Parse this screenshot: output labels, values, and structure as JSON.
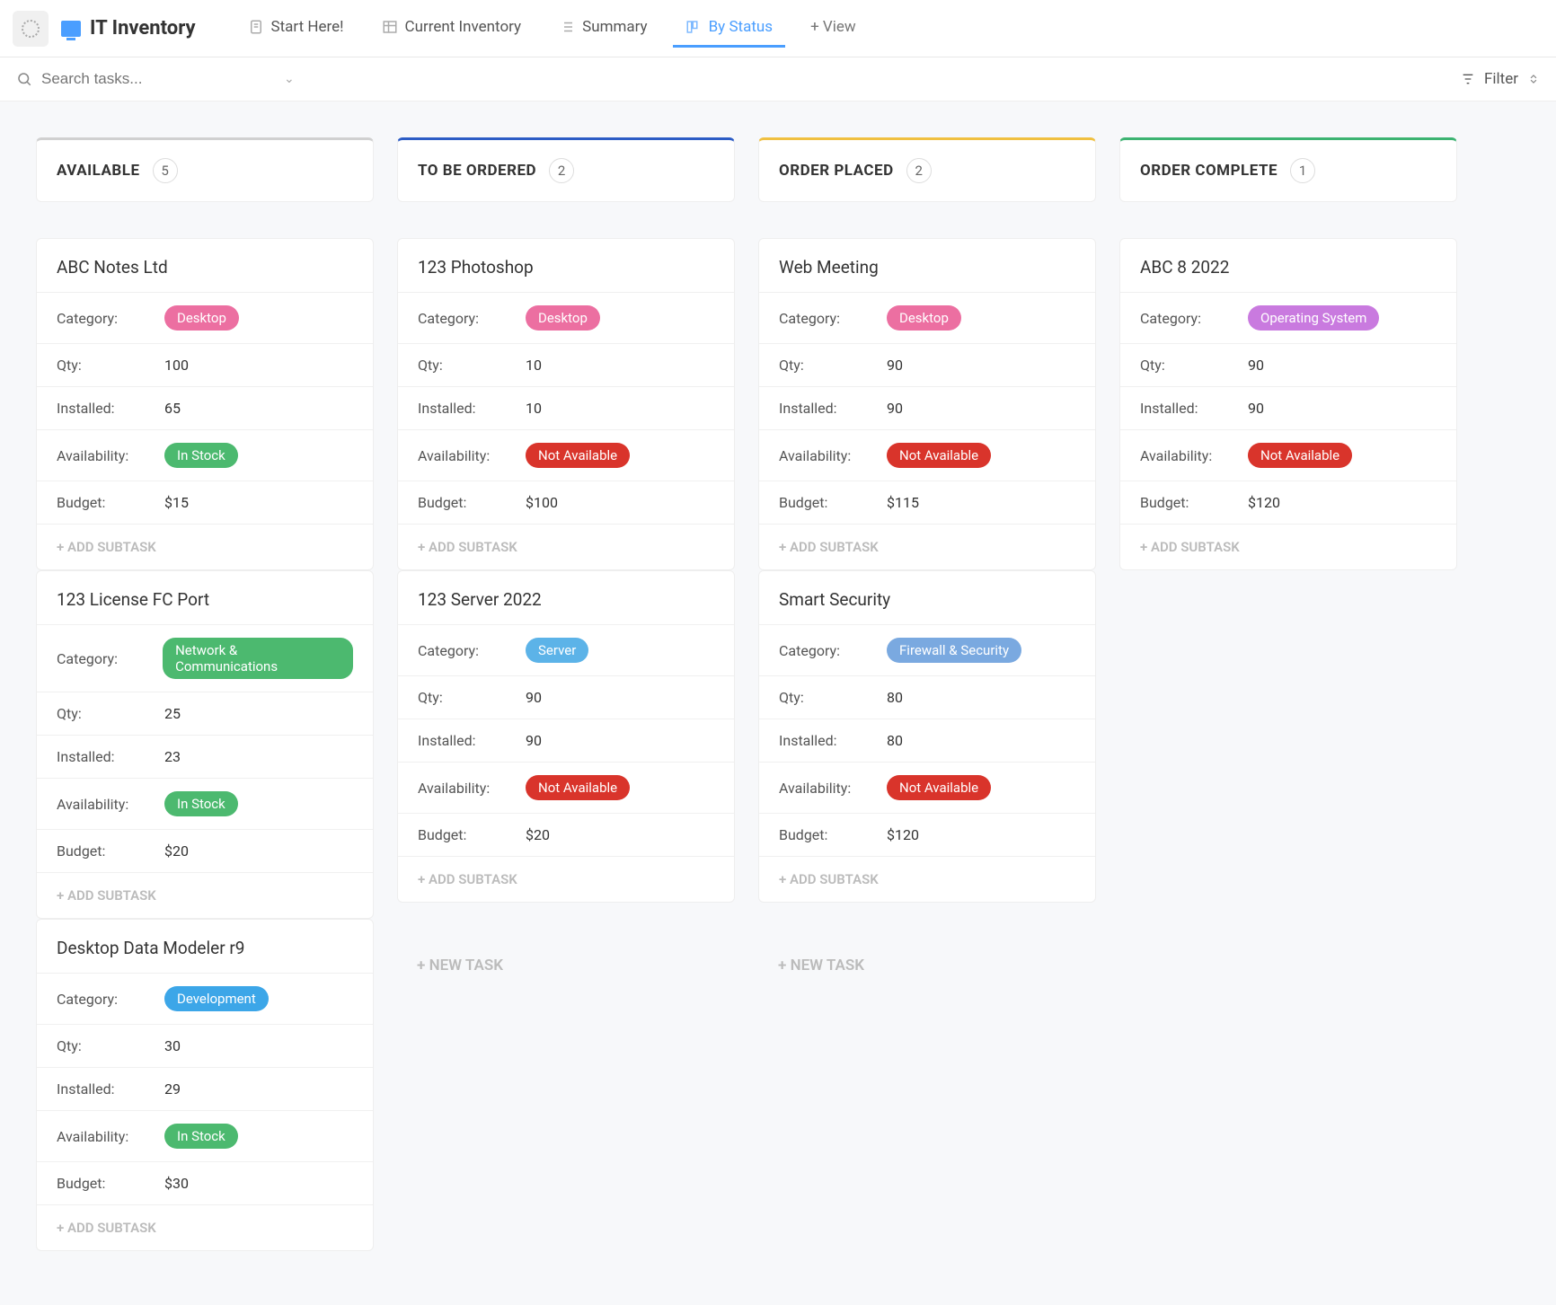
{
  "header": {
    "title": "IT Inventory",
    "tabs": [
      {
        "label": "Start Here!"
      },
      {
        "label": "Current Inventory"
      },
      {
        "label": "Summary"
      },
      {
        "label": "By Status"
      }
    ],
    "add_view": "+  View"
  },
  "search": {
    "placeholder": "Search tasks...",
    "filter_label": "Filter"
  },
  "labels": {
    "category": "Category:",
    "qty": "Qty:",
    "installed": "Installed:",
    "availability": "Availability:",
    "budget": "Budget:",
    "add_subtask": "+ ADD SUBTASK",
    "new_task": "+ NEW TASK"
  },
  "columns": [
    {
      "key": "available",
      "title": "AVAILABLE",
      "count": "5",
      "cards": [
        {
          "title": "ABC Notes Ltd",
          "category": "Desktop",
          "category_pill": "pill-desktop",
          "qty": "100",
          "installed": "65",
          "availability": "In Stock",
          "avail_pill": "pill-instock",
          "budget": "$15"
        },
        {
          "title": "123 License FC Port",
          "category": "Network & Communications",
          "category_pill": "pill-network",
          "qty": "25",
          "installed": "23",
          "availability": "In Stock",
          "avail_pill": "pill-instock",
          "budget": "$20"
        },
        {
          "title": "Desktop Data Modeler r9",
          "category": "Development",
          "category_pill": "pill-development",
          "qty": "30",
          "installed": "29",
          "availability": "In Stock",
          "avail_pill": "pill-instock",
          "budget": "$30"
        }
      ]
    },
    {
      "key": "tobeordered",
      "title": "TO BE ORDERED",
      "count": "2",
      "cards": [
        {
          "title": "123 Photoshop",
          "category": "Desktop",
          "category_pill": "pill-desktop",
          "qty": "10",
          "installed": "10",
          "availability": "Not Available",
          "avail_pill": "pill-notavail",
          "budget": "$100"
        },
        {
          "title": "123 Server 2022",
          "category": "Server",
          "category_pill": "pill-server",
          "qty": "90",
          "installed": "90",
          "availability": "Not Available",
          "avail_pill": "pill-notavail",
          "budget": "$20"
        }
      ],
      "show_new_task": true
    },
    {
      "key": "orderplaced",
      "title": "ORDER PLACED",
      "count": "2",
      "cards": [
        {
          "title": "Web Meeting",
          "category": "Desktop",
          "category_pill": "pill-desktop",
          "qty": "90",
          "installed": "90",
          "availability": "Not Available",
          "avail_pill": "pill-notavail",
          "budget": "$115"
        },
        {
          "title": "Smart Security",
          "category": "Firewall & Security",
          "category_pill": "pill-firewall",
          "qty": "80",
          "installed": "80",
          "availability": "Not Available",
          "avail_pill": "pill-notavail",
          "budget": "$120"
        }
      ],
      "show_new_task": true
    },
    {
      "key": "ordercomplete",
      "title": "ORDER COMPLETE",
      "count": "1",
      "cards": [
        {
          "title": "ABC 8 2022",
          "category": "Operating System",
          "category_pill": "pill-os",
          "qty": "90",
          "installed": "90",
          "availability": "Not Available",
          "avail_pill": "pill-notavail",
          "budget": "$120"
        }
      ]
    }
  ]
}
